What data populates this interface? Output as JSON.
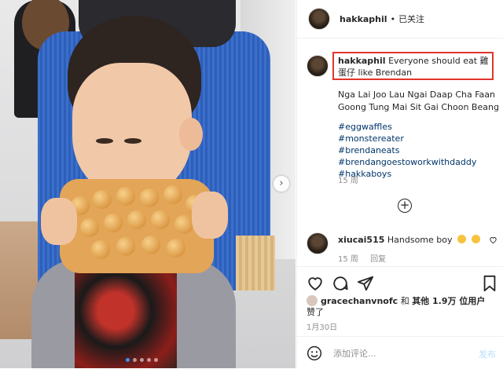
{
  "post": {
    "username": "hakkaphil",
    "separator": "•",
    "follow_status": "已关注",
    "caption_user": "hakkaphil",
    "caption_text": "Everyone should eat 雞蛋仔 like Brendan",
    "romanized": "Nga Lai Joo Lau Ngai Daap Cha Faan Goong Tung Mai Sit Gai Choon Beang",
    "hashtags": [
      "#eggwaffles",
      "#monstereater",
      "#brendaneats",
      "#brendangoestoworkwithdaddy",
      "#hakkaboys"
    ],
    "caption_age": "15 周"
  },
  "comment": {
    "username": "xiucai515",
    "text": "Handsome boy",
    "emojis": [
      "grinning-face",
      "grinning-face"
    ],
    "age": "15 周",
    "reply_label": "回复"
  },
  "likes": {
    "user": "gracechanvnofc",
    "connector": "和",
    "others": "其他 1.9万 位用户",
    "suffix": "赞了"
  },
  "date": "1月30日",
  "comment_input": {
    "placeholder": "添加评论...",
    "post_label": "发布"
  },
  "carousel": {
    "slides": 5,
    "active": 1
  },
  "icons": {
    "next": "chevron-right-icon",
    "load_more": "plus-circle-icon",
    "like": "heart-icon",
    "comment": "comment-icon",
    "share": "paper-plane-icon",
    "save": "bookmark-icon",
    "emoji": "smiley-icon"
  },
  "colors": {
    "highlight_box": "#e0362d",
    "hashtag": "#003569",
    "muted": "#8e8e8e",
    "post_disabled": "#b2dffc"
  }
}
